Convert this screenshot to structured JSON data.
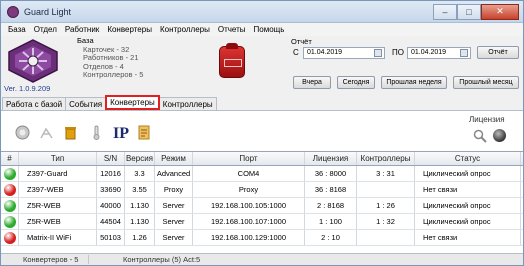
{
  "window": {
    "title": "Guard Light",
    "minimize": "–",
    "maximize": "□",
    "close": "✕"
  },
  "menu": [
    "База",
    "Отдел",
    "Работник",
    "Конвертеры",
    "Контроллеры",
    "Отчеты",
    "Помощь"
  ],
  "header": {
    "version": "Ver. 1.0.9.209",
    "stats": {
      "title": "База",
      "cards": "Карточек - 32",
      "workers": "Работников - 21",
      "departments": "Отделов - 4",
      "controllers": "Контроллеров - 5"
    }
  },
  "report": {
    "label": "Отчёт",
    "from_label": "С",
    "from_date": "01.04.2019",
    "to_label": "ПО",
    "to_date": "01.04.2019",
    "report_button": "Отчёт",
    "yesterday": "Вчера",
    "today": "Сегодня",
    "last_week": "Прошлая неделя",
    "last_month": "Прошлый месяц"
  },
  "tabs": [
    "Работа с базой",
    "События",
    "Конвертеры",
    "Контроллеры"
  ],
  "active_tab": "Конвертеры",
  "toolbar": {
    "icons": [
      "search-device-icon",
      "network-icon",
      "delete-icon",
      "thermometer-icon",
      "ip-settings-icon",
      "document-icon"
    ],
    "license_label": "Лицензия"
  },
  "table": {
    "columns": [
      "#",
      "Тип",
      "S/N",
      "Версия",
      "Режим",
      "Порт",
      "Лицензия",
      "Контроллеры",
      "Статус"
    ],
    "rows": [
      {
        "status_color": "#2eaa2e",
        "type": "Z397-Guard",
        "sn": "12016",
        "version": "3.3",
        "mode": "Advanced",
        "port": "COM4",
        "license": "36 : 8000",
        "controllers": "3 : 31",
        "status": "Циклический опрос"
      },
      {
        "status_color": "#d42020",
        "type": "Z397-WEB",
        "sn": "33690",
        "version": "3.55",
        "mode": "Proxy",
        "port": "Proxy",
        "license": "36 : 8168",
        "controllers": "",
        "status": "Нет связи"
      },
      {
        "status_color": "#2eaa2e",
        "type": "Z5R-WEB",
        "sn": "40000",
        "version": "1.130",
        "mode": "Server",
        "port": "192.168.100.105:1000",
        "license": "2 : 8168",
        "controllers": "1 : 26",
        "status": "Циклический опрос"
      },
      {
        "status_color": "#2eaa2e",
        "type": "Z5R-WEB",
        "sn": "44504",
        "version": "1.130",
        "mode": "Server",
        "port": "192.168.100.107:1000",
        "license": "1 : 100",
        "controllers": "1 : 32",
        "status": "Циклический опрос"
      },
      {
        "status_color": "#d42020",
        "type": "Matrix-II WiFi",
        "sn": "50103",
        "version": "1.26",
        "mode": "Server",
        "port": "192.168.100.129:1000",
        "license": "2 : 10",
        "controllers": "",
        "status": "Нет связи"
      }
    ]
  },
  "statusbar": {
    "converters": "Конвертеров - 5",
    "controllers": "Контроллеры (5) Act:5"
  }
}
